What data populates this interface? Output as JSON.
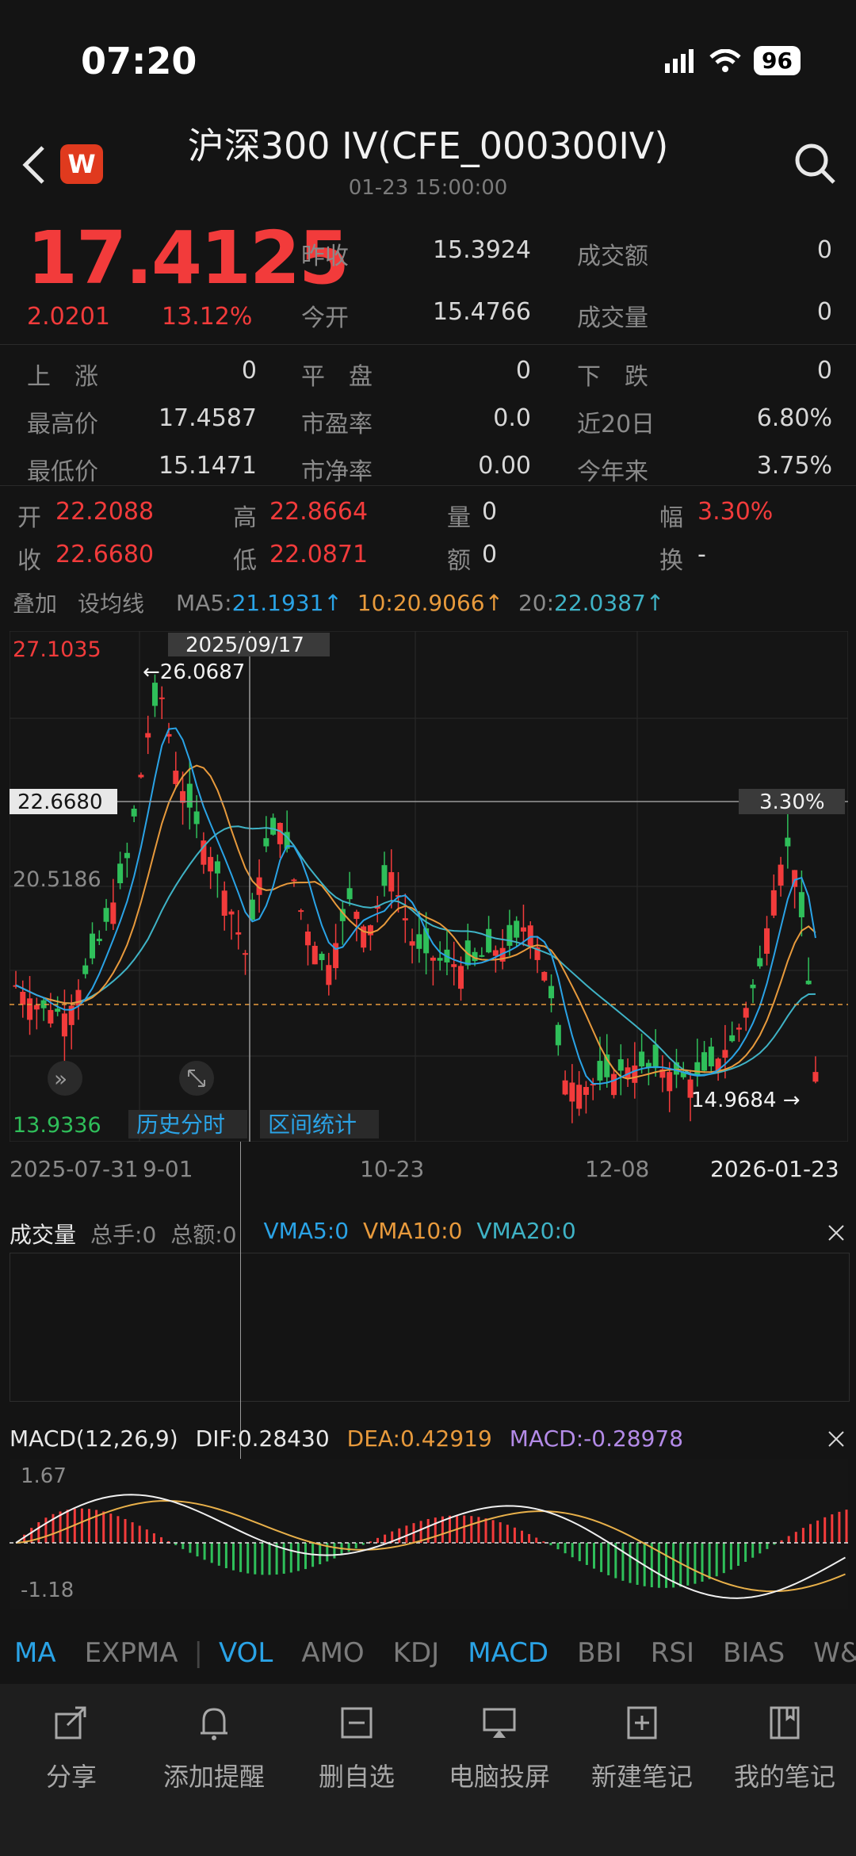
{
  "status": {
    "time": "07:20",
    "battery": "96"
  },
  "header": {
    "title": "沪深300 IV(CFE_000300IV)",
    "subtitle": "01-23 15:00:00",
    "app_badge": "W"
  },
  "quote": {
    "price": "17.4125",
    "change": "2.0201",
    "change_pct": "13.12%",
    "row1": [
      {
        "label": "昨收",
        "value": "15.3924"
      },
      {
        "label": "成交额",
        "value": "0"
      }
    ],
    "row2": [
      {
        "label": "今开",
        "value": "15.4766"
      },
      {
        "label": "成交量",
        "value": "0"
      }
    ]
  },
  "stats": [
    [
      {
        "label": "上　涨",
        "value": "0"
      },
      {
        "label": "平　盘",
        "value": "0"
      },
      {
        "label": "下　跌",
        "value": "0"
      }
    ],
    [
      {
        "label": "最高价",
        "value": "17.4587"
      },
      {
        "label": "市盈率",
        "value": "0.0"
      },
      {
        "label": "近20日",
        "value": "6.80%"
      }
    ],
    [
      {
        "label": "最低价",
        "value": "15.1471"
      },
      {
        "label": "市净率",
        "value": "0.00"
      },
      {
        "label": "今年来",
        "value": "3.75%"
      }
    ]
  ],
  "ohlc": {
    "open_label": "开",
    "open": "22.2088",
    "high_label": "高",
    "high": "22.8664",
    "vol_label": "量",
    "vol": "0",
    "amp_label": "幅",
    "amp": "3.30%",
    "close_label": "收",
    "close": "22.6680",
    "low_label": "低",
    "low": "22.0871",
    "amt_label": "额",
    "amt": "0",
    "turn_label": "换",
    "turn": "-"
  },
  "ma_bar": {
    "overlay": "叠加",
    "set_ma": "设均线",
    "ma5_label": "MA5:",
    "ma5": "21.1931↑",
    "ma10_label": "10:",
    "ma10": "20.9066↑",
    "ma20_label": "20:",
    "ma20": "22.0387↑"
  },
  "kline": {
    "top_label": "27.1035",
    "mid_label": "20.5186",
    "bottom_label": "13.9336",
    "cursor_date": "2025/09/17",
    "cursor_price": "22.6680",
    "cursor_pct": "3.30%",
    "max_marker": "←26.0687",
    "min_marker": "14.9684 →",
    "hist_btn": "历史分时",
    "range_btn": "区间统计",
    "dates": [
      "2025-07-31",
      "9-01",
      "10-23",
      "12-08",
      "2026-01-23"
    ]
  },
  "volume": {
    "title": "成交量",
    "total_hands": "总手:0",
    "total_amt": "总额:0",
    "vma5": "VMA5:0",
    "vma10": "VMA10:0",
    "vma20": "VMA20:0"
  },
  "macd": {
    "title": "MACD(12,26,9)",
    "dif": "DIF:0.28430",
    "dea": "DEA:0.42919",
    "macd": "MACD:-0.28978",
    "top": "1.67",
    "bottom": "-1.18"
  },
  "ind_tabs": [
    "MA",
    "EXPMA",
    "VOL",
    "AMO",
    "KDJ",
    "MACD",
    "BBI",
    "RSI",
    "BIAS",
    "W&"
  ],
  "bottom_bar": [
    {
      "label": "分享",
      "icon": "share-icon"
    },
    {
      "label": "添加提醒",
      "icon": "bell-icon"
    },
    {
      "label": "删自选",
      "icon": "remove-watchlist-icon"
    },
    {
      "label": "电脑投屏",
      "icon": "cast-icon"
    },
    {
      "label": "新建笔记",
      "icon": "new-note-icon"
    },
    {
      "label": "我的笔记",
      "icon": "notebook-icon"
    }
  ],
  "colors": {
    "up": "#f23b3b",
    "down": "#2fbf5a",
    "ma5": "#2aa3e6",
    "ma10": "#e89a3c",
    "ma20": "#3fb3c6"
  }
}
